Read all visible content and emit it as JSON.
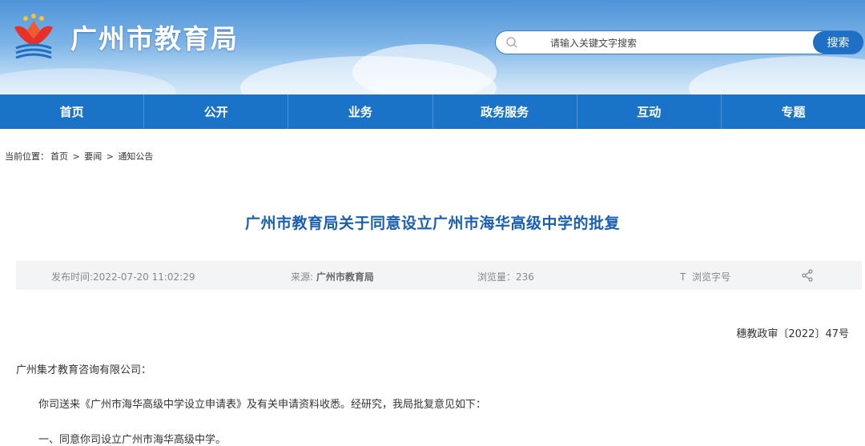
{
  "header": {
    "site_title": "广州市教育局",
    "search_placeholder": "请输入关键文字搜索",
    "search_button": "搜索"
  },
  "nav": [
    "首页",
    "公开",
    "业务",
    "政务服务",
    "互动",
    "专题"
  ],
  "breadcrumb": {
    "label": "当前位置：",
    "items": [
      "首页",
      "要闻",
      "通知公告"
    ],
    "separator": ">"
  },
  "article": {
    "title": "广州市教育局关于同意设立广州市海华高级中学的批复",
    "meta": {
      "publish_time": "发布时间:2022-07-20 11:02:29",
      "source_label": "来源:",
      "source_value": "广州市教育局",
      "views": "浏览量：236",
      "font_size_label": "T  浏览字号"
    },
    "doc_number": "穗教政审〔2022〕47号",
    "salutation": "广州集才教育咨询有限公司：",
    "paragraphs": [
      "你司送来《广州市海华高级中学设立申请表》及有关申请资料收悉。经研究，我局批复意见如下：",
      "一、同意你司设立广州市海华高级中学。"
    ]
  },
  "colors": {
    "nav_bg": "#1a73c7",
    "title_color": "#1a5fb0",
    "search_button_bg": "#1f6fc4"
  }
}
